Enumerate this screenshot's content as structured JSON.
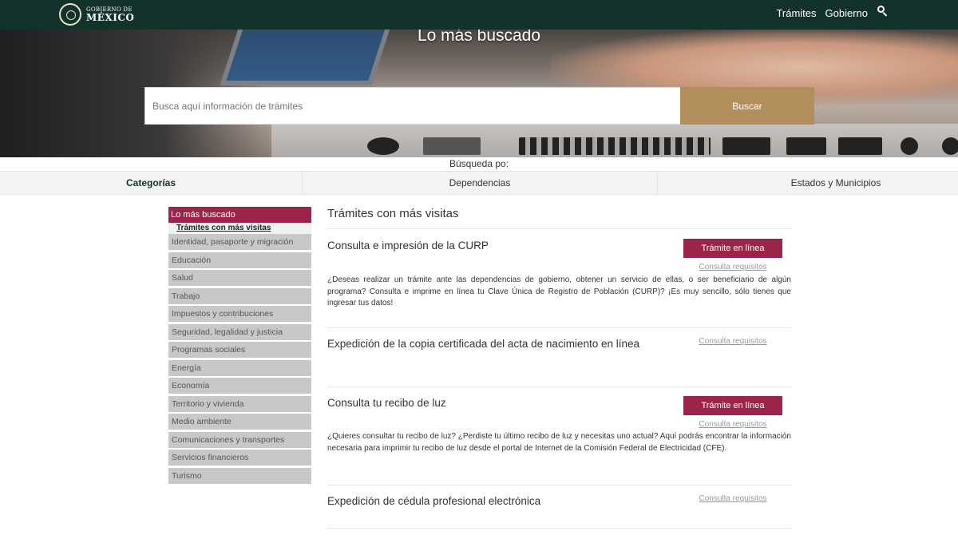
{
  "header": {
    "logo_top": "GOBIERNO DE",
    "logo_bottom": "MÉXICO",
    "nav": [
      "Trámites",
      "Gobierno"
    ],
    "search_icon": "search-icon"
  },
  "hero": {
    "title": "Lo más buscado",
    "search_placeholder": "Busca aquí información de trámites",
    "search_button": "Buscar"
  },
  "filters": {
    "label": "Búsqueda po:",
    "tabs": [
      "Categorías",
      "Dependencias",
      "Estados y Municipios"
    ],
    "active": "Categorías"
  },
  "sidebar": {
    "header": "Lo más buscado",
    "sub": "Trámites con más visitas",
    "items": [
      "Identidad, pasaporte y migración",
      "Educación",
      "Salud",
      "Trabajo",
      "Impuestos y contribuciones",
      "Seguridad, legalidad y justicia",
      "Programas sociales",
      "Energía",
      "Economía",
      "Territorio y vivienda",
      "Medio ambiente",
      "Comunicaciones y transportes",
      "Servicios financieros",
      "Turismo"
    ]
  },
  "main": {
    "title": "Trámites con más visitas",
    "tramites": [
      {
        "name": "Consulta e impresión de la CURP",
        "online_button": "Trámite en línea",
        "requirements": "Consulta requisitos",
        "description": "¿Deseas realizar un trámite ante las dependencias de gobierno, obtener un servicio de ellas, o ser beneficiario de algún programa? Consulta e imprime en línea tu Clave Única de Registro de Población (CURP)? ¡Es muy sencillo, sólo tienes que ingresar tus datos!"
      },
      {
        "name": "Expedición de la copia certificada del acta de nacimiento en línea",
        "requirements": "Consulta requisitos"
      },
      {
        "name": "Consulta tu recibo de luz",
        "online_button": "Trámite en línea",
        "requirements": "Consulta requisitos",
        "description": "¿Quieres consultar tu recibo de luz? ¿Perdiste tu último recibo de luz y necesitas uno actual? Aquí podrás encontrar la información necesaria para imprimir tu recibo de luz desde el portal de Internet de la Comisión Federal de Electricidad (CFE)."
      },
      {
        "name": "Expedición de cédula profesional electrónica",
        "requirements": "Consulta requisitos"
      }
    ]
  },
  "colors": {
    "nav_bg": "#13322b",
    "accent_red": "#9d2449",
    "accent_gold": "#b38e5d",
    "sidebar_gray": "#c8c8c8"
  }
}
